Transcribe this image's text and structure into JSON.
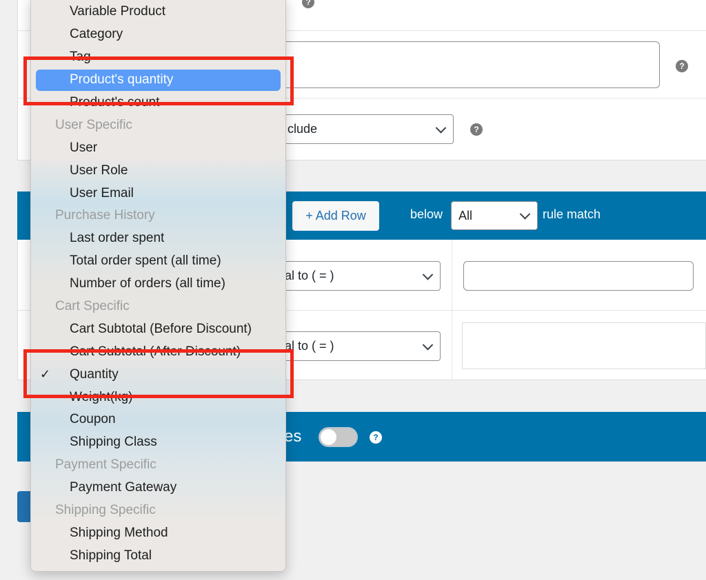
{
  "background": {
    "condition_select_partial": "clude",
    "rules_bar": {
      "add_row_label": "+ Add Row",
      "below_label": "below",
      "match_select_value": "All",
      "rule_match_label": "rule match"
    },
    "rule_rows": [
      {
        "operator_partial": "al to ( = )",
        "value": ""
      },
      {
        "operator_partial": "al to ( = )",
        "value": ""
      }
    ],
    "bottom_bar": {
      "label_partial": "es",
      "toggle_on": false
    },
    "help_icon_glyph": "?"
  },
  "dropdown": {
    "items": [
      {
        "type": "option",
        "label": "Variable Product"
      },
      {
        "type": "option",
        "label": "Category"
      },
      {
        "type": "option",
        "label": "Tag"
      },
      {
        "type": "option",
        "label": "Product's quantity",
        "highlighted": true
      },
      {
        "type": "option",
        "label": "Product's count"
      },
      {
        "type": "group",
        "label": "User Specific"
      },
      {
        "type": "option",
        "label": "User"
      },
      {
        "type": "option",
        "label": "User Role"
      },
      {
        "type": "option",
        "label": "User Email"
      },
      {
        "type": "group",
        "label": "Purchase History"
      },
      {
        "type": "option",
        "label": "Last order spent"
      },
      {
        "type": "option",
        "label": "Total order spent (all time)"
      },
      {
        "type": "option",
        "label": "Number of orders (all time)"
      },
      {
        "type": "group",
        "label": "Cart Specific"
      },
      {
        "type": "option",
        "label": "Cart Subtotal (Before Discount)"
      },
      {
        "type": "option",
        "label": "Cart Subtotal (After Discount)"
      },
      {
        "type": "option",
        "label": "Quantity",
        "checked": true
      },
      {
        "type": "option",
        "label": "Weight(kg)"
      },
      {
        "type": "option",
        "label": "Coupon"
      },
      {
        "type": "option",
        "label": "Shipping Class"
      },
      {
        "type": "group",
        "label": "Payment Specific"
      },
      {
        "type": "option",
        "label": "Payment Gateway"
      },
      {
        "type": "group",
        "label": "Shipping Specific"
      },
      {
        "type": "option",
        "label": "Shipping Method"
      },
      {
        "type": "option",
        "label": "Shipping Total"
      }
    ],
    "check_glyph": "✓"
  },
  "colors": {
    "wp_blue": "#0073aa",
    "highlight": "#5a9cf7",
    "annotation_red": "#f0281b"
  }
}
